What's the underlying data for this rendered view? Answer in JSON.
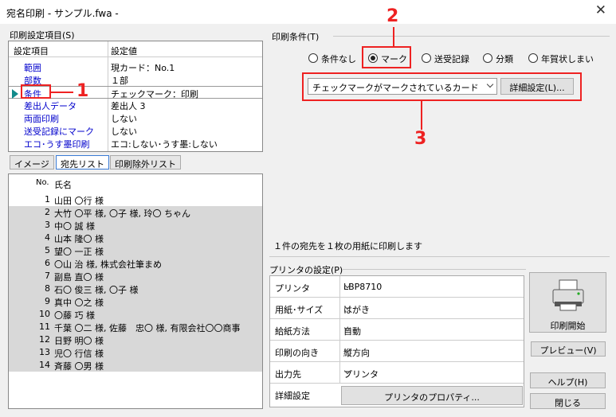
{
  "window": {
    "title": "宛名印刷 - サンプル.fwa -",
    "close_label": "✕"
  },
  "left": {
    "section_label": "印刷設定項目(S)",
    "settings_header": {
      "item": "設定項目",
      "value": "設定値"
    },
    "settings_rows": [
      {
        "item": "範囲",
        "value": "現カード：No.1"
      },
      {
        "item": "部数",
        "value": "１部"
      },
      {
        "item": "条件",
        "value": "チェックマーク：印刷"
      },
      {
        "item": "差出人データ",
        "value": "差出人 3"
      },
      {
        "item": "両面印刷",
        "value": "しない"
      },
      {
        "item": "送受記録にマーク",
        "value": "しない"
      },
      {
        "item": "エコ･うす墨印刷",
        "value": "エコ:しない･うす墨:しない"
      }
    ],
    "tabs": [
      "イメージ",
      "宛先リスト",
      "印刷除外リスト"
    ],
    "list_header": {
      "no": "No.",
      "name": "氏名"
    },
    "list_rows": [
      {
        "no": "1",
        "name": "山田 〇行 様"
      },
      {
        "no": "2",
        "name": "大竹 〇平 様, 〇子 様, 玲〇 ちゃん"
      },
      {
        "no": "3",
        "name": "中〇 誠 様"
      },
      {
        "no": "4",
        "name": "山本 隆〇 様"
      },
      {
        "no": "5",
        "name": "望〇 一正 様"
      },
      {
        "no": "6",
        "name": "〇山 治 様, 株式会社筆まめ"
      },
      {
        "no": "7",
        "name": "副島 直〇 様"
      },
      {
        "no": "8",
        "name": "石〇 俊三 様, 〇子 様"
      },
      {
        "no": "9",
        "name": "真中 〇之 様"
      },
      {
        "no": "10",
        "name": "〇藤 巧 様"
      },
      {
        "no": "11",
        "name": "千葉 〇二 様, 佐藤　忠〇 様, 有限会社〇〇商事"
      },
      {
        "no": "12",
        "name": "日野 明〇 様"
      },
      {
        "no": "13",
        "name": "児〇 行信 様"
      },
      {
        "no": "14",
        "name": "斉藤 〇男 様"
      }
    ]
  },
  "right": {
    "conditions_label": "印刷条件(T)",
    "radios": [
      {
        "label": "条件なし",
        "checked": false
      },
      {
        "label": "マーク",
        "checked": true
      },
      {
        "label": "送受記録",
        "checked": false
      },
      {
        "label": "分類",
        "checked": false
      },
      {
        "label": "年賀状しまい",
        "checked": false
      }
    ],
    "mark_select": "チェックマークがマークされているカード",
    "detail_button": "詳細設定(L)...",
    "message": "１件の宛先を１枚の用紙に印刷します",
    "printer_label": "プリンタの設定(P)",
    "printer_rows": [
      {
        "key": "プリンタ",
        "value": "LBP8710"
      },
      {
        "key": "用紙･サイズ",
        "value": "はがき"
      },
      {
        "key": "給紙方法",
        "value": "自動"
      },
      {
        "key": "印刷の向き",
        "value": "縦方向"
      },
      {
        "key": "出力先",
        "value": "プリンタ"
      }
    ],
    "detail_row_key": "詳細設定",
    "properties_button": "プリンタのプロパティ...",
    "buttons": {
      "print": "印刷開始",
      "preview": "プレビュー(V)",
      "help": "ヘルプ(H)",
      "close": "閉じる"
    }
  },
  "annotations": {
    "one": "1",
    "two": "2",
    "three": "3"
  },
  "colors": {
    "annotation": "#e22222",
    "marker": "#118a8a",
    "link": "#0000cc"
  }
}
